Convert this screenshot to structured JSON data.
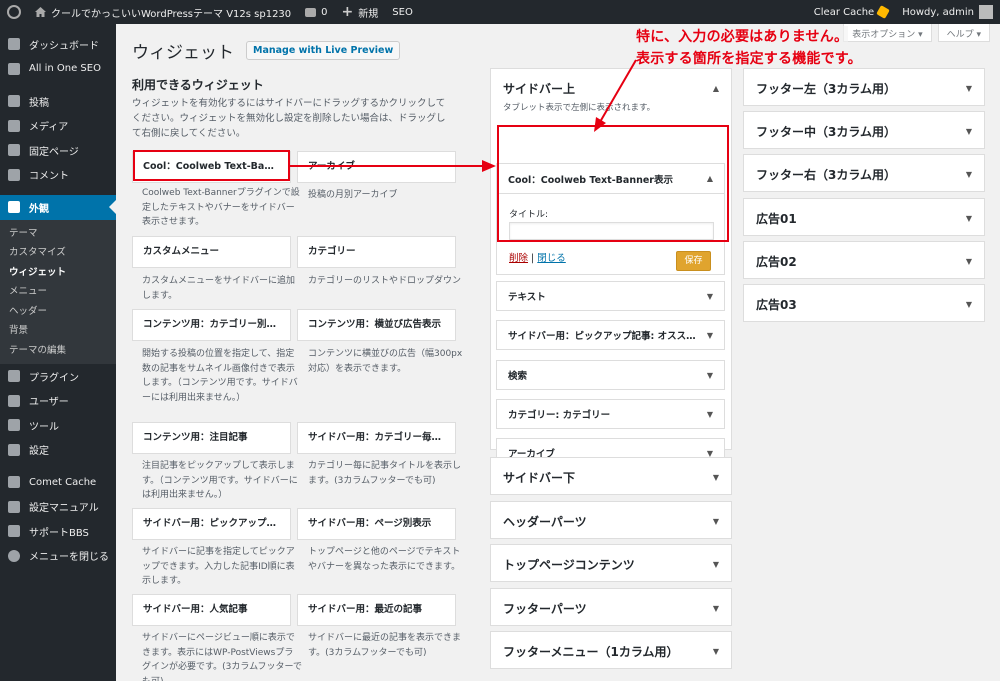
{
  "admin_bar": {
    "site_name": "クールでかっこいいWordPressテーマ V12s sp1230",
    "comments_count": "0",
    "new_label": "新規",
    "seo_label": "SEO",
    "clear_cache": "Clear Cache",
    "howdy": "Howdy, admin"
  },
  "sidebar": {
    "items": [
      {
        "label": "ダッシュボード",
        "icon": "dashboard-icon"
      },
      {
        "label": "All in One SEO",
        "icon": "aioseo-icon"
      },
      {
        "label": "投稿",
        "icon": "pin-icon"
      },
      {
        "label": "メディア",
        "icon": "media-icon"
      },
      {
        "label": "固定ページ",
        "icon": "page-icon"
      },
      {
        "label": "コメント",
        "icon": "comment-icon"
      },
      {
        "label": "外観",
        "icon": "paintbrush-icon"
      },
      {
        "label": "プラグイン",
        "icon": "plugin-icon"
      },
      {
        "label": "ユーザー",
        "icon": "user-icon"
      },
      {
        "label": "ツール",
        "icon": "wrench-icon"
      },
      {
        "label": "設定",
        "icon": "settings-icon"
      },
      {
        "label": "Comet Cache",
        "icon": "comet-icon"
      },
      {
        "label": "設定マニュアル",
        "icon": "gear-icon"
      },
      {
        "label": "サポートBBS",
        "icon": "gear-icon"
      },
      {
        "label": "メニューを閉じる",
        "icon": "collapse-icon"
      }
    ],
    "submenu": [
      "テーマ",
      "カスタマイズ",
      "ウィジェット",
      "メニュー",
      "ヘッダー",
      "背景",
      "テーマの編集"
    ]
  },
  "page": {
    "title": "ウィジェット",
    "live_preview": "Manage with Live Preview",
    "screen_options": "表示オプション",
    "help": "ヘルプ",
    "available_heading": "利用できるウィジェット",
    "available_desc": "ウィジェットを有効化するにはサイドバーにドラッグするかクリックしてください。ウィジェットを無効化し設定を削除したい場合は、ドラッグして右側に戻してください。"
  },
  "widgets": [
    {
      "title": "Cool：Coolweb Text-Banne…",
      "desc": "Coolweb Text-Bannerプラグインで設定したテキストやバナーをサイドバー表示させます。"
    },
    {
      "title": "アーカイブ",
      "desc": "投稿の月別アーカイブ"
    },
    {
      "title": "カスタムメニュー",
      "desc": "カスタムメニューをサイドバーに追加します。"
    },
    {
      "title": "カテゴリー",
      "desc": "カテゴリーのリストやドロップダウン"
    },
    {
      "title": "コンテンツ用：カテゴリー別…",
      "desc": "開始する投稿の位置を指定して、指定数の記事をサムネイル画像付きで表示します。（コンテンツ用です。サイドバーには利用出来ません。）"
    },
    {
      "title": "コンテンツ用：横並び広告表示",
      "desc": "コンテンツに横並びの広告（幅300px対応）を表示できます。"
    },
    {
      "title": "コンテンツ用：注目記事",
      "desc": "注目記事をピックアップして表示します。（コンテンツ用です。サイドバーには利用出来ません。）"
    },
    {
      "title": "サイドバー用：カテゴリー毎…",
      "desc": "カテゴリー毎に記事タイトルを表示します。(3カラムフッターでも可)"
    },
    {
      "title": "サイドバー用：ピックアップ…",
      "desc": "サイドバーに記事を指定してピックアップできます。入力した記事ID順に表示します。"
    },
    {
      "title": "サイドバー用：ページ別表示",
      "desc": "トップページと他のページでテキストやバナーを異なった表示にできます。"
    },
    {
      "title": "サイドバー用：人気記事",
      "desc": "サイドバーにページビュー順に表示できます。表示にはWP-PostViewsプラグインが必要です。(3カラムフッターでも可)"
    },
    {
      "title": "サイドバー用：最近の記事",
      "desc": "サイドバーに最近の記事を表示できます。(3カラムフッターでも可)"
    }
  ],
  "sidebar_top": {
    "title": "サイドバー上",
    "desc": "タブレット表示で左側に表示されます。",
    "expanded_widget": {
      "title": "Cool：Coolweb Text-Banner表示",
      "field_label": "タイトル:",
      "field_value": "",
      "delete": "削除",
      "divider": "|",
      "close": "閉じる",
      "save": "保存"
    },
    "widgets": [
      "テキスト",
      "サイドバー用：ピックアップ記事: オスス…",
      "検索",
      "カテゴリー: カテゴリー",
      "アーカイブ"
    ]
  },
  "middle_areas": [
    "サイドバー下",
    "ヘッダーパーツ",
    "トップページコンテンツ",
    "フッターパーツ",
    "フッターメニュー（1カラム用）"
  ],
  "right_areas": [
    "フッター左（3カラム用）",
    "フッター中（3カラム用）",
    "フッター右（3カラム用）",
    "広告01",
    "広告02",
    "広告03"
  ],
  "annotation": {
    "line1": "特に、入力の必要はありません。",
    "line2": "表示する箇所を指定する機能です。"
  },
  "colors": {
    "sidebar_bg": "#23282d",
    "accent": "#0073aa",
    "save_button": "#e0a42e",
    "annotation": "#e60012"
  }
}
